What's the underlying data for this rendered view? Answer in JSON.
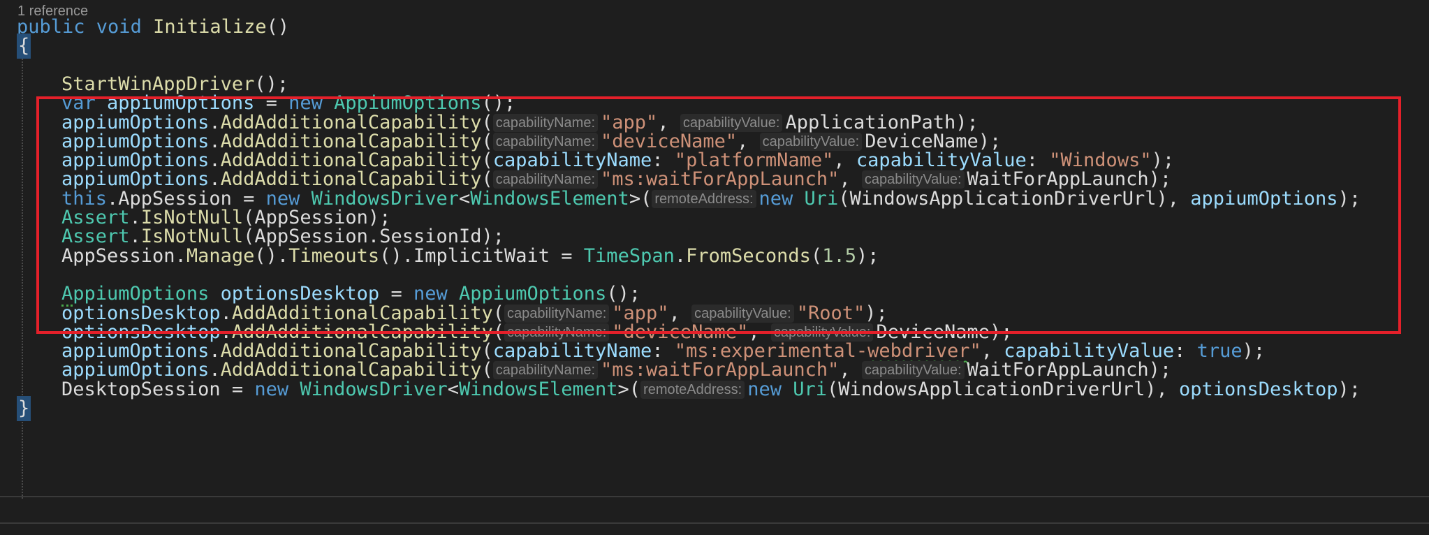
{
  "codelens": "1 reference",
  "lines": [
    {
      "segments": [
        {
          "t": "public ",
          "c": "kw"
        },
        {
          "t": "void ",
          "c": "kw"
        },
        {
          "t": "Initialize",
          "c": "fn"
        },
        {
          "t": "()",
          "c": "plain"
        }
      ]
    },
    {
      "segments": [
        {
          "t": "{",
          "c": "brace"
        }
      ]
    },
    {
      "segments": []
    },
    {
      "segments": [
        {
          "t": "StartWinAppDriver",
          "c": "fn"
        },
        {
          "t": "();",
          "c": "plain"
        }
      ]
    },
    {
      "segments": [
        {
          "t": "var ",
          "c": "kw"
        },
        {
          "t": "appiumOptions",
          "c": "var"
        },
        {
          "t": " = ",
          "c": "plain"
        },
        {
          "t": "new ",
          "c": "kw"
        },
        {
          "t": "AppiumOptions",
          "c": "ty"
        },
        {
          "t": "();",
          "c": "plain"
        }
      ]
    },
    {
      "segments": [
        {
          "t": "appiumOptions",
          "c": "var"
        },
        {
          "t": ".",
          "c": "plain"
        },
        {
          "t": "AddAdditionalCapability",
          "c": "fn"
        },
        {
          "t": "(",
          "c": "plain"
        },
        {
          "t": "capabilityName:",
          "c": "hint"
        },
        {
          "t": "\"app\"",
          "c": "str"
        },
        {
          "t": ", ",
          "c": "plain"
        },
        {
          "t": "capabilityValue:",
          "c": "hint"
        },
        {
          "t": "ApplicationPath",
          "c": "plain"
        },
        {
          "t": ");",
          "c": "plain"
        }
      ]
    },
    {
      "segments": [
        {
          "t": "appiumOptions",
          "c": "var"
        },
        {
          "t": ".",
          "c": "plain"
        },
        {
          "t": "AddAdditionalCapability",
          "c": "fn"
        },
        {
          "t": "(",
          "c": "plain"
        },
        {
          "t": "capabilityName:",
          "c": "hint"
        },
        {
          "t": "\"deviceName\"",
          "c": "str"
        },
        {
          "t": ", ",
          "c": "plain"
        },
        {
          "t": "capabilityValue:",
          "c": "hint"
        },
        {
          "t": "DeviceName",
          "c": "plain"
        },
        {
          "t": ");",
          "c": "plain"
        }
      ]
    },
    {
      "segments": [
        {
          "t": "appiumOptions",
          "c": "var"
        },
        {
          "t": ".",
          "c": "plain"
        },
        {
          "t": "AddAdditionalCapability",
          "c": "fn"
        },
        {
          "t": "(",
          "c": "plain"
        },
        {
          "t": "capabilityName",
          "c": "var"
        },
        {
          "t": ": ",
          "c": "plain"
        },
        {
          "t": "\"platformName\"",
          "c": "str"
        },
        {
          "t": ", ",
          "c": "plain"
        },
        {
          "t": "capabilityValue",
          "c": "var"
        },
        {
          "t": ": ",
          "c": "plain"
        },
        {
          "t": "\"Windows\"",
          "c": "str"
        },
        {
          "t": ");",
          "c": "plain"
        }
      ]
    },
    {
      "segments": [
        {
          "t": "appiumOptions",
          "c": "var"
        },
        {
          "t": ".",
          "c": "plain"
        },
        {
          "t": "AddAdditionalCapability",
          "c": "fn"
        },
        {
          "t": "(",
          "c": "plain"
        },
        {
          "t": "capabilityName:",
          "c": "hint"
        },
        {
          "t": "\"ms:waitForAppLaunch\"",
          "c": "str"
        },
        {
          "t": ", ",
          "c": "plain"
        },
        {
          "t": "capabilityValue:",
          "c": "hint"
        },
        {
          "t": "WaitForAppLaunch",
          "c": "plain"
        },
        {
          "t": ");",
          "c": "plain"
        }
      ]
    },
    {
      "segments": [
        {
          "t": "this",
          "c": "kw"
        },
        {
          "t": ".AppSession = ",
          "c": "plain"
        },
        {
          "t": "new ",
          "c": "kw"
        },
        {
          "t": "WindowsDriver",
          "c": "ty"
        },
        {
          "t": "<",
          "c": "plain"
        },
        {
          "t": "WindowsElement",
          "c": "ty"
        },
        {
          "t": ">(",
          "c": "plain"
        },
        {
          "t": "remoteAddress:",
          "c": "hint"
        },
        {
          "t": "new ",
          "c": "kw"
        },
        {
          "t": "Uri",
          "c": "ty"
        },
        {
          "t": "(WindowsApplicationDriverUrl), ",
          "c": "plain"
        },
        {
          "t": "appiumOptions",
          "c": "var"
        },
        {
          "t": ");",
          "c": "plain"
        }
      ]
    },
    {
      "segments": [
        {
          "t": "Assert",
          "c": "ty"
        },
        {
          "t": ".",
          "c": "plain"
        },
        {
          "t": "IsNotNull",
          "c": "fn"
        },
        {
          "t": "(AppSession);",
          "c": "plain"
        }
      ]
    },
    {
      "segments": [
        {
          "t": "Assert",
          "c": "ty"
        },
        {
          "t": ".",
          "c": "plain"
        },
        {
          "t": "IsNotNull",
          "c": "fn"
        },
        {
          "t": "(AppSession.SessionId);",
          "c": "plain"
        }
      ]
    },
    {
      "segments": [
        {
          "t": "AppSession.",
          "c": "plain"
        },
        {
          "t": "Manage",
          "c": "fn"
        },
        {
          "t": "().",
          "c": "plain"
        },
        {
          "t": "Timeouts",
          "c": "fn"
        },
        {
          "t": "().ImplicitWait = ",
          "c": "plain"
        },
        {
          "t": "TimeSpan",
          "c": "ty"
        },
        {
          "t": ".",
          "c": "plain"
        },
        {
          "t": "FromSeconds",
          "c": "fn"
        },
        {
          "t": "(",
          "c": "plain"
        },
        {
          "t": "1.5",
          "c": "num"
        },
        {
          "t": ");",
          "c": "plain"
        }
      ]
    },
    {
      "segments": []
    },
    {
      "segments": [
        {
          "t": "AppiumOptions",
          "c": "ty dotfirst"
        },
        {
          "t": " ",
          "c": "plain"
        },
        {
          "t": "optionsDesktop",
          "c": "var"
        },
        {
          "t": " = ",
          "c": "plain"
        },
        {
          "t": "new ",
          "c": "kw"
        },
        {
          "t": "AppiumOptions",
          "c": "ty"
        },
        {
          "t": "();",
          "c": "plain"
        }
      ]
    },
    {
      "segments": [
        {
          "t": "optionsDesktop",
          "c": "var"
        },
        {
          "t": ".",
          "c": "plain"
        },
        {
          "t": "AddAdditionalCapability",
          "c": "fn"
        },
        {
          "t": "(",
          "c": "plain"
        },
        {
          "t": "capabilityName:",
          "c": "hint"
        },
        {
          "t": "\"app\"",
          "c": "str"
        },
        {
          "t": ", ",
          "c": "plain"
        },
        {
          "t": "capabilityValue:",
          "c": "hint"
        },
        {
          "t": "\"Root\"",
          "c": "str"
        },
        {
          "t": ");",
          "c": "plain"
        }
      ]
    },
    {
      "segments": [
        {
          "t": "optionsDesktop",
          "c": "var"
        },
        {
          "t": ".",
          "c": "plain"
        },
        {
          "t": "AddAdditionalCapability",
          "c": "fn"
        },
        {
          "t": "(",
          "c": "plain"
        },
        {
          "t": "capabilityName:",
          "c": "hint"
        },
        {
          "t": "\"deviceName\"",
          "c": "str"
        },
        {
          "t": ", ",
          "c": "plain"
        },
        {
          "t": "capabilityValue:",
          "c": "hint"
        },
        {
          "t": "DeviceName",
          "c": "plain"
        },
        {
          "t": ");",
          "c": "plain"
        }
      ]
    },
    {
      "segments": [
        {
          "t": "appiumOptions",
          "c": "var"
        },
        {
          "t": ".",
          "c": "plain"
        },
        {
          "t": "AddAdditionalCapability",
          "c": "fn"
        },
        {
          "t": "(",
          "c": "plain"
        },
        {
          "t": "capabilityName",
          "c": "var"
        },
        {
          "t": ": ",
          "c": "plain"
        },
        {
          "t": "\"ms:experimental-",
          "c": "str"
        },
        {
          "t": "webdriver",
          "c": "str squiggle"
        },
        {
          "t": "\"",
          "c": "str"
        },
        {
          "t": ", ",
          "c": "plain"
        },
        {
          "t": "capabilityValue",
          "c": "var"
        },
        {
          "t": ": ",
          "c": "plain"
        },
        {
          "t": "true",
          "c": "kw"
        },
        {
          "t": ");",
          "c": "plain"
        }
      ]
    },
    {
      "segments": [
        {
          "t": "appiumOptions",
          "c": "var"
        },
        {
          "t": ".",
          "c": "plain"
        },
        {
          "t": "AddAdditionalCapability",
          "c": "fn"
        },
        {
          "t": "(",
          "c": "plain"
        },
        {
          "t": "capabilityName:",
          "c": "hint"
        },
        {
          "t": "\"ms:waitForAppLaunch\"",
          "c": "str"
        },
        {
          "t": ", ",
          "c": "plain"
        },
        {
          "t": "capabilityValue:",
          "c": "hint"
        },
        {
          "t": "WaitForAppLaunch",
          "c": "plain"
        },
        {
          "t": ");",
          "c": "plain"
        }
      ]
    },
    {
      "segments": [
        {
          "t": "DesktopSession = ",
          "c": "plain"
        },
        {
          "t": "new ",
          "c": "kw"
        },
        {
          "t": "WindowsDriver",
          "c": "ty"
        },
        {
          "t": "<",
          "c": "plain"
        },
        {
          "t": "WindowsElement",
          "c": "ty"
        },
        {
          "t": ">(",
          "c": "plain"
        },
        {
          "t": "remoteAddress:",
          "c": "hint"
        },
        {
          "t": "new ",
          "c": "kw"
        },
        {
          "t": "Uri",
          "c": "ty"
        },
        {
          "t": "(WindowsApplicationDriverUrl), ",
          "c": "plain"
        },
        {
          "t": "optionsDesktop",
          "c": "var"
        },
        {
          "t": ");",
          "c": "plain"
        }
      ]
    },
    {
      "segments": [
        {
          "t": "}",
          "c": "brace"
        }
      ]
    }
  ]
}
